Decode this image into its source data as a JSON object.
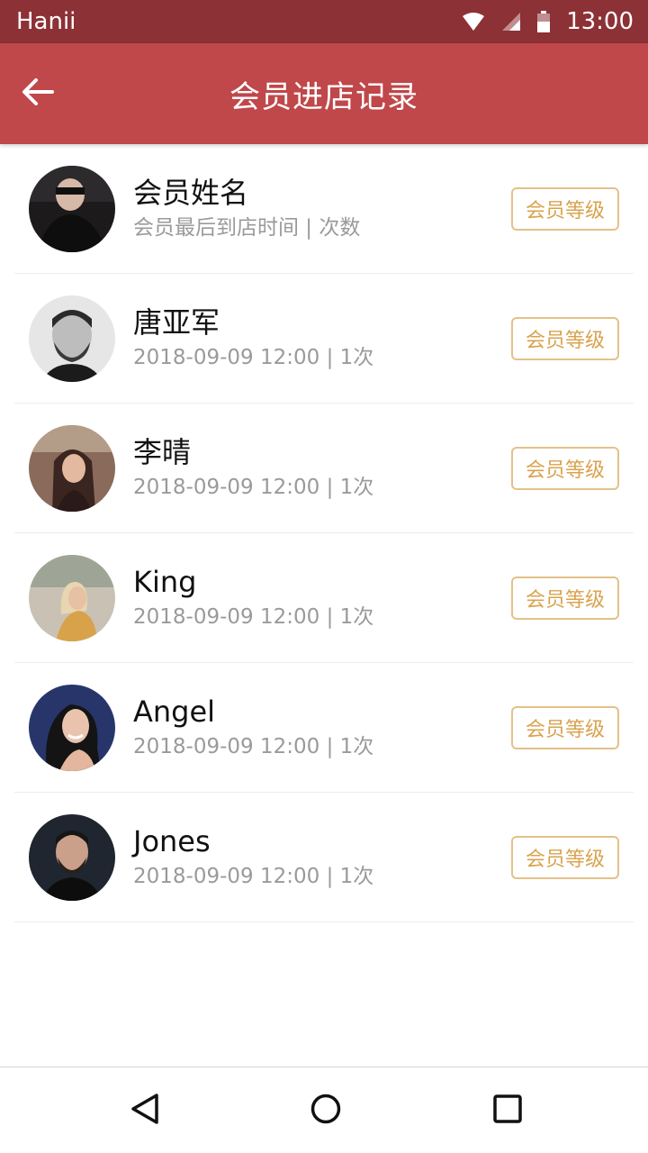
{
  "status_bar": {
    "carrier": "Hanii",
    "time": "13:00",
    "icons": [
      "wifi-icon",
      "signal-icon",
      "battery-icon"
    ]
  },
  "app_bar": {
    "back_icon": "arrow-left-icon",
    "title": "会员进店记录"
  },
  "members": [
    {
      "name": "会员姓名",
      "meta": "会员最后到店时间 | 次数",
      "badge": "会员等级",
      "avatar": "person-dark-sunglasses"
    },
    {
      "name": "唐亚军",
      "meta": "2018-09-09 12:00 | 1次",
      "badge": "会员等级",
      "avatar": "bearded-man-bw"
    },
    {
      "name": "李晴",
      "meta": "2018-09-09 12:00 | 1次",
      "badge": "会员等级",
      "avatar": "woman-long-hair"
    },
    {
      "name": "King",
      "meta": "2018-09-09 12:00 | 1次",
      "badge": "会员等级",
      "avatar": "blonde-woman-outdoors"
    },
    {
      "name": "Angel",
      "meta": "2018-09-09 12:00 | 1次",
      "badge": "会员等级",
      "avatar": "smiling-woman-dark-hair"
    },
    {
      "name": "Jones",
      "meta": "2018-09-09 12:00 | 1次",
      "badge": "会员等级",
      "avatar": "bearded-man-dark"
    }
  ],
  "colors": {
    "status_bar": "#8c3136",
    "app_bar": "#c0474a",
    "badge_border": "#e4c189",
    "badge_text": "#d9a34f"
  },
  "nav_bar": {
    "icons": [
      "nav-back-icon",
      "nav-home-icon",
      "nav-recents-icon"
    ]
  }
}
